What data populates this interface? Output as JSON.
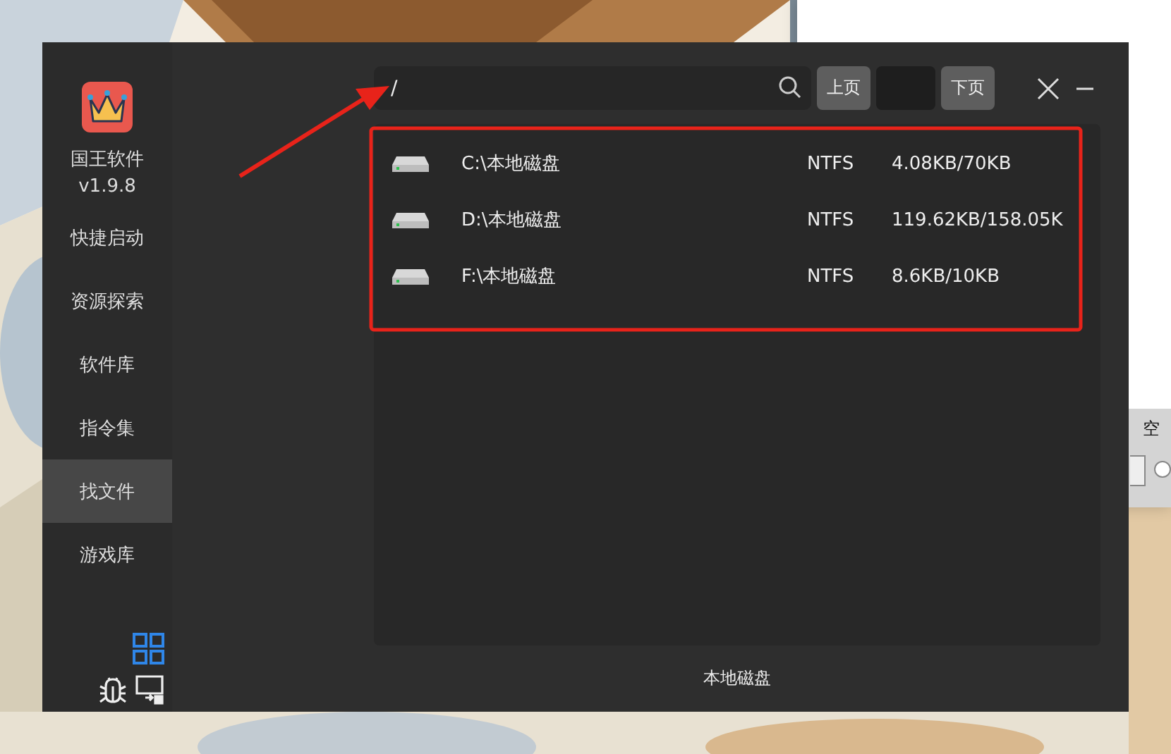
{
  "back_window": {
    "label": "空",
    "radio_selected": false
  },
  "app": {
    "name": "国王软件",
    "version": "v1.9.8"
  },
  "nav": [
    {
      "label": "快捷启动",
      "selected": false
    },
    {
      "label": "资源探索",
      "selected": false
    },
    {
      "label": "软件库",
      "selected": false
    },
    {
      "label": "指令集",
      "selected": false
    },
    {
      "label": "找文件",
      "selected": true
    },
    {
      "label": "游戏库",
      "selected": false
    }
  ],
  "search": {
    "value": "/"
  },
  "pager": {
    "prev": "上页",
    "next": "下页"
  },
  "drives": [
    {
      "path": "C:\\本地磁盘",
      "fs": "NTFS",
      "usage": "4.08KB/70KB"
    },
    {
      "path": "D:\\本地磁盘",
      "fs": "NTFS",
      "usage": "119.62KB/158.05K"
    },
    {
      "path": "F:\\本地磁盘",
      "fs": "NTFS",
      "usage": "8.6KB/10KB"
    }
  ],
  "footer": "本地磁盘"
}
